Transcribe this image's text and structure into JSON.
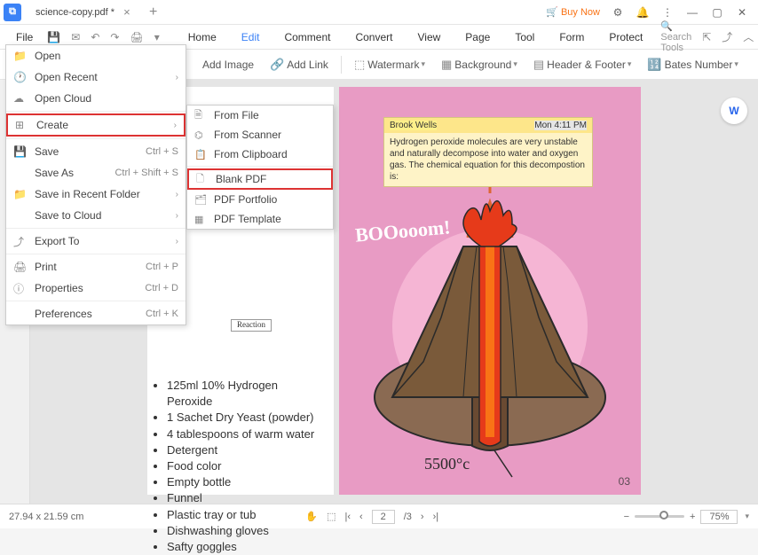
{
  "titlebar": {
    "tab_title": "science-copy.pdf *",
    "buy_now": "Buy Now"
  },
  "menubar": {
    "file": "File",
    "tabs": [
      "Home",
      "Edit",
      "Comment",
      "Convert",
      "View",
      "Page",
      "Tool",
      "Form",
      "Protect"
    ],
    "search_placeholder": "Search Tools"
  },
  "toolbar": {
    "add_image": "Add Image",
    "add_link": "Add Link",
    "watermark": "Watermark",
    "background": "Background",
    "header_footer": "Header & Footer",
    "bates_number": "Bates Number"
  },
  "file_menu": {
    "open": "Open",
    "open_recent": "Open Recent",
    "open_cloud": "Open Cloud",
    "create": "Create",
    "save": "Save",
    "save_as": "Save As",
    "save_recent": "Save in Recent Folder",
    "save_cloud": "Save to Cloud",
    "export": "Export To",
    "print": "Print",
    "properties": "Properties",
    "preferences": "Preferences",
    "shortcuts": {
      "save": "Ctrl + S",
      "save_as": "Ctrl + Shift + S",
      "print": "Ctrl + P",
      "properties": "Ctrl + D",
      "preferences": "Ctrl + K"
    }
  },
  "create_submenu": {
    "from_file": "From File",
    "from_scanner": "From Scanner",
    "from_clipboard": "From Clipboard",
    "blank_pdf": "Blank PDF",
    "pdf_portfolio": "PDF Portfolio",
    "pdf_template": "PDF Template"
  },
  "document": {
    "reaction_label": "Reaction",
    "list_items": [
      "125ml 10% Hydrogen Peroxide",
      "1 Sachet Dry Yeast (powder)",
      "4 tablespoons of warm water",
      "Detergent",
      "Food color",
      "Empty bottle",
      "Funnel",
      "Plastic tray or tub",
      "Dishwashing gloves",
      "Safty goggles"
    ],
    "boom_text": "BOOooom!",
    "temperature": "5500°c",
    "page_number": "03",
    "note": {
      "author": "Brook Wells",
      "time": "Mon 4:11 PM",
      "body": "Hydrogen peroxide molecules are very unstable and naturally decompose into water and oxygen gas. The chemical equation for this decompostion is:"
    }
  },
  "statusbar": {
    "dimensions": "27.94 x 21.59 cm",
    "current_page": "2",
    "total_pages": "/3",
    "zoom": "75%"
  }
}
